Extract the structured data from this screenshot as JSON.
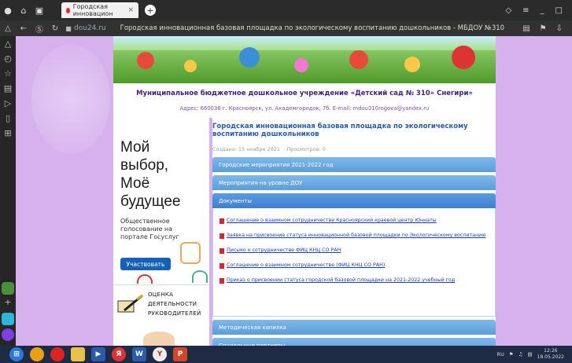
{
  "browser": {
    "tab_title": "Городская инновацион",
    "domain": "dou24.ru",
    "page_title": "Городская инновационная базовая площадка по экологическому воспитанию дошкольников - МБДОУ №310"
  },
  "site": {
    "org_name": "Муниципальное бюджетное дошкольное учреждение «Детский сад № 310» Снегири»",
    "address": "Адрес: 660036 г. Красноярск, ул. Академгородок, 7б. E-mail: mdou310rogova@yandex.ru"
  },
  "promo": {
    "title_line1": "Мой",
    "title_line2": "выбор,",
    "title_line3": "Моё",
    "title_line4": "будущее",
    "subtitle": "Общественное голосование на портале Госуслуг",
    "button": "Участвовать",
    "eval_line1": "ОЦЕНКА",
    "eval_line2": "ДЕЯТЕЛЬНОСТИ",
    "eval_line3": "РУКОВОДИТЕЛЕЙ"
  },
  "article": {
    "title": "Городская инновационная базовая площадка по экологическому воспитанию дошкольников",
    "created": "Создано: 15 ноября 2021",
    "views": "Просмотров: 0"
  },
  "accordion": [
    {
      "label": "Городские мероприятия 2021-2022 год"
    },
    {
      "label": "Мероприятия на уровне ДОУ"
    },
    {
      "label": "Документы"
    }
  ],
  "documents": [
    "Соглашение о взаимном сотрудничестве Красноярский краевой центр Юннаты",
    "Заявка на присвоение статуса инновационной базовой площадки по Экологическому воспитанию",
    "Письмо о сотрудничестве ФИЦ КНЦ СО РАН",
    "Соглашение о взаимном сотрудничестве (ФИЦ КНЦ СО РАН)",
    "Приказ о присвоении статуса городской базовой площадки на 2021-2022 учебный год"
  ],
  "accordion_bottom": [
    {
      "label": "Методическая копилка"
    },
    {
      "label": "Социальные партнеры"
    }
  ],
  "taskbar": {
    "lang": "RU",
    "time": "12:26",
    "date": "18.05.2022"
  }
}
